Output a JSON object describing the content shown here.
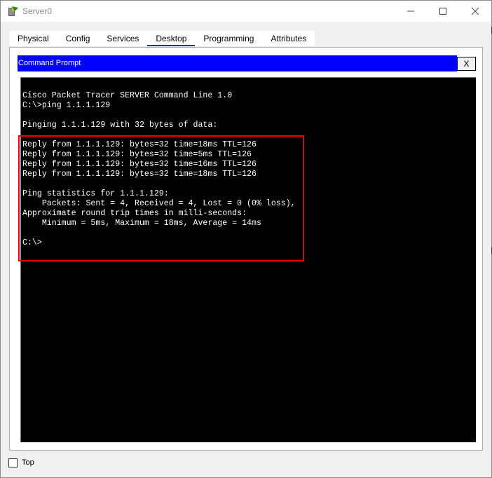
{
  "window": {
    "title": "Server0",
    "icon": "packet-tracer-server-icon",
    "controls": [
      "minimize-icon",
      "maximize-icon",
      "close-icon"
    ]
  },
  "tabs": [
    {
      "label": "Physical",
      "active": false
    },
    {
      "label": "Config",
      "active": false
    },
    {
      "label": "Services",
      "active": false
    },
    {
      "label": "Desktop",
      "active": true
    },
    {
      "label": "Programming",
      "active": false
    },
    {
      "label": "Attributes",
      "active": false
    }
  ],
  "command_prompt": {
    "title": "Command Prompt",
    "close_label": "X",
    "lines": [
      "Cisco Packet Tracer SERVER Command Line 1.0",
      "C:\\>ping 1.1.1.129",
      "",
      "Pinging 1.1.1.129 with 32 bytes of data:",
      "",
      "Reply from 1.1.1.129: bytes=32 time=18ms TTL=126",
      "Reply from 1.1.1.129: bytes=32 time=5ms TTL=126",
      "Reply from 1.1.1.129: bytes=32 time=16ms TTL=126",
      "Reply from 1.1.1.129: bytes=32 time=18ms TTL=126",
      "",
      "Ping statistics for 1.1.1.129:",
      "    Packets: Sent = 4, Received = 4, Lost = 0 (0% loss),",
      "Approximate round trip times in milli-seconds:",
      "    Minimum = 5ms, Maximum = 18ms, Average = 14ms",
      "",
      "C:\\>"
    ],
    "highlight_color": "#e60000"
  },
  "footer": {
    "top_checkbox_label": "Top",
    "top_checked": false
  },
  "colors": {
    "header_blue": "#0000ff",
    "terminal_bg": "#000000",
    "terminal_fg": "#ffffff",
    "active_tab_underline": "#1f3d73"
  }
}
